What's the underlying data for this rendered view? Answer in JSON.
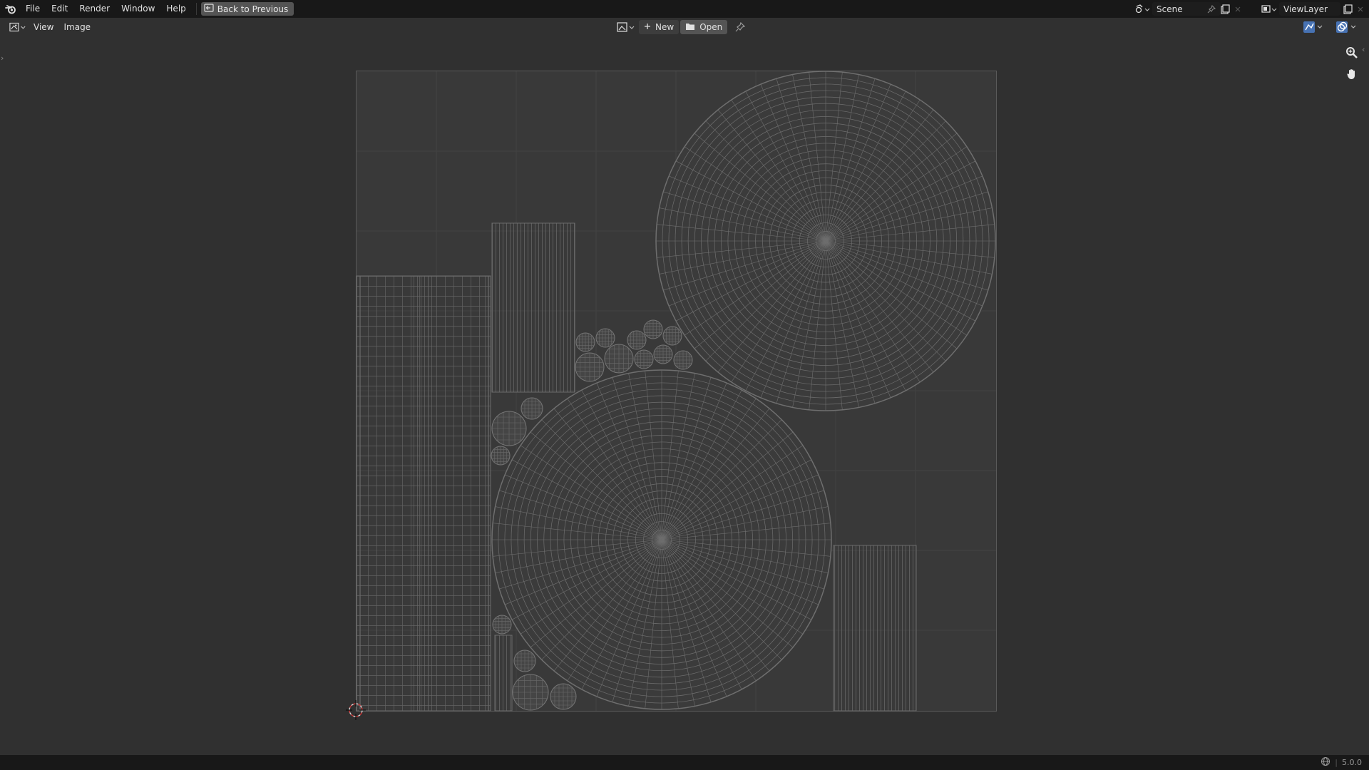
{
  "topbar": {
    "menus": [
      "File",
      "Edit",
      "Render",
      "Window",
      "Help"
    ],
    "back_label": "Back to Previous",
    "scene_value": "Scene",
    "viewlayer_value": "ViewLayer"
  },
  "header": {
    "menus": [
      "View",
      "Image"
    ],
    "new_label": "New",
    "open_label": "Open"
  },
  "status": {
    "version": "5.0.0"
  },
  "colors": {
    "background": "#303030",
    "bar": "#181818",
    "wire": "#6e6e6e"
  },
  "icons": [
    "blender-logo-icon",
    "back-icon",
    "scene-icon",
    "pin-icon",
    "new-scene-icon",
    "close-icon",
    "viewlayer-icon",
    "editor-type-icon",
    "image-icon",
    "plus-icon",
    "folder-icon",
    "uv-sync-icon",
    "overlay-icon",
    "zoom-icon",
    "hand-icon",
    "cursor-icon",
    "network-icon"
  ]
}
